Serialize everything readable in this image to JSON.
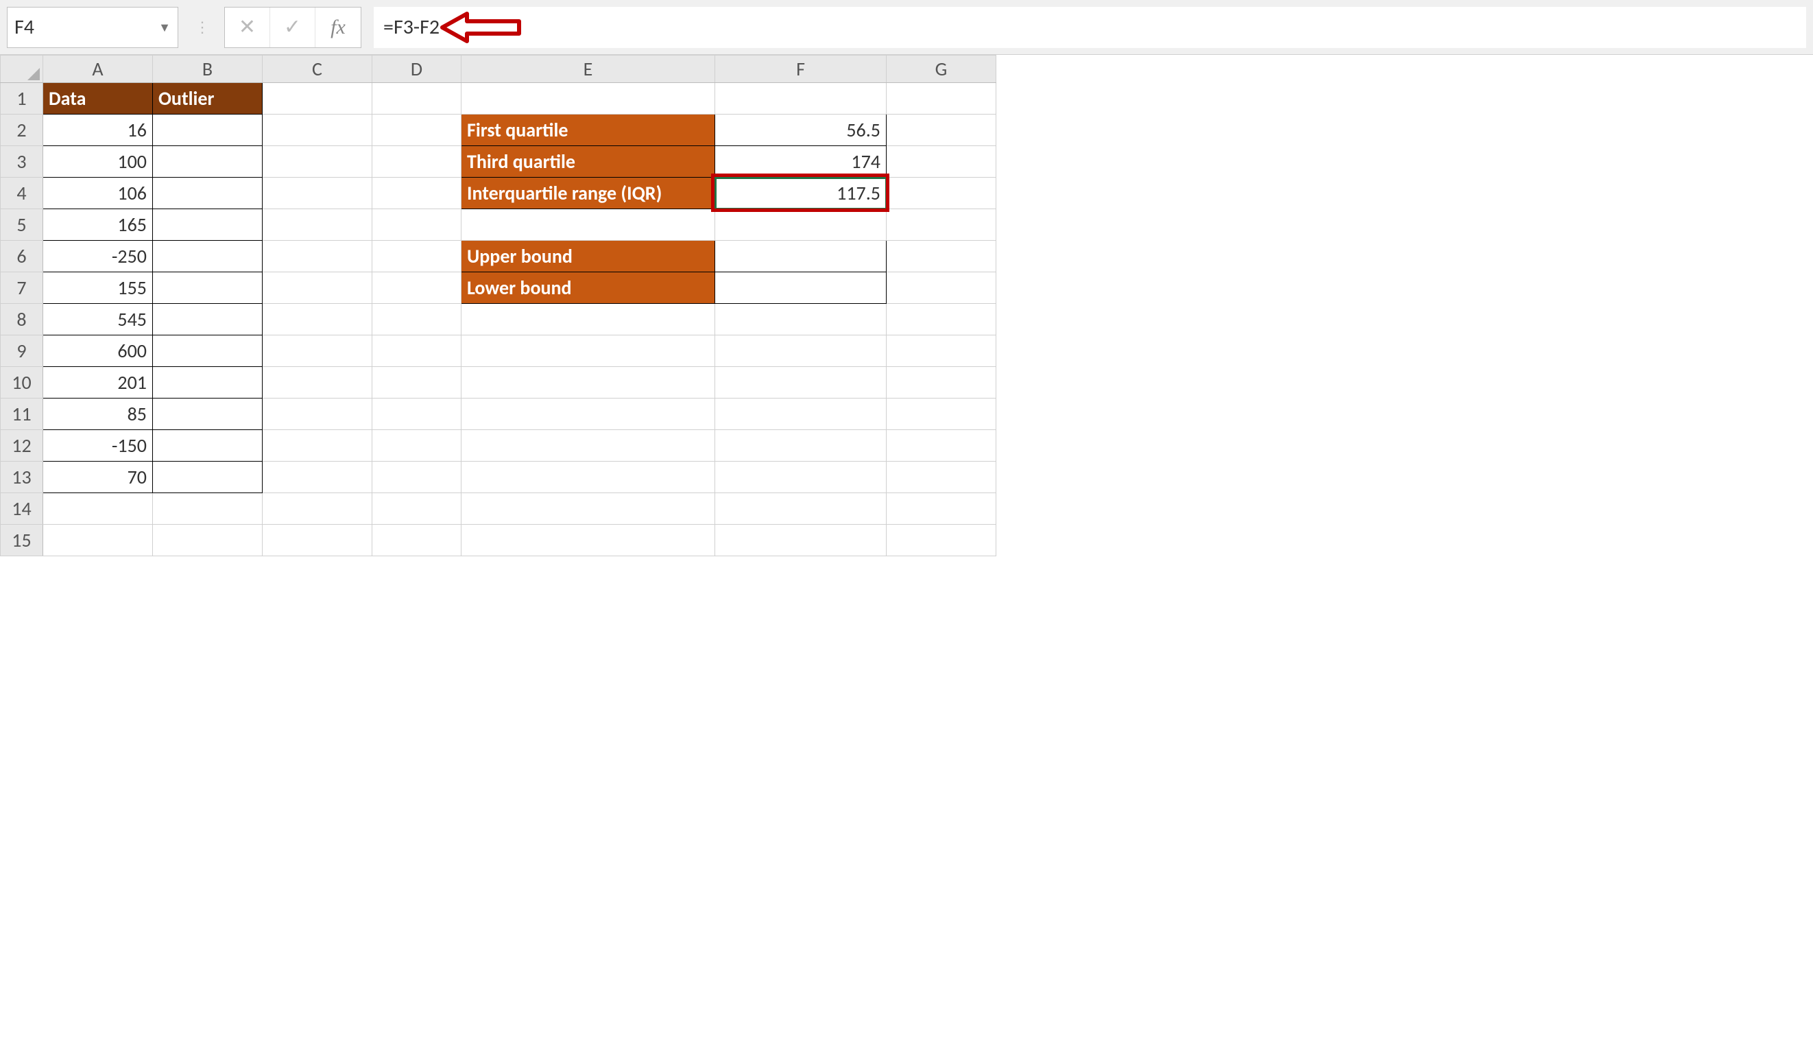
{
  "formula_bar": {
    "name_box": "F4",
    "cancel_icon": "✕",
    "enter_icon": "✓",
    "fx_icon": "fx",
    "formula": "=F3-F2"
  },
  "columns": [
    "A",
    "B",
    "C",
    "D",
    "E",
    "F",
    "G"
  ],
  "rows": [
    "1",
    "2",
    "3",
    "4",
    "5",
    "6",
    "7",
    "8",
    "9",
    "10",
    "11",
    "12",
    "13",
    "14",
    "15"
  ],
  "active_cell": {
    "row": "4",
    "col": "F"
  },
  "headers": {
    "A1": "Data",
    "B1": "Outlier"
  },
  "data_values": {
    "A2": "16",
    "A3": "100",
    "A4": "106",
    "A5": "165",
    "A6": "-250",
    "A7": "155",
    "A8": "545",
    "A9": "600",
    "A10": "201",
    "A11": "85",
    "A12": "-150",
    "A13": "70"
  },
  "labels": {
    "E2": "First quartile",
    "E3": "Third quartile",
    "E4": "Interquartile range (IQR)",
    "E6": "Upper bound",
    "E7": "Lower bound"
  },
  "values": {
    "F2": "56.5",
    "F3": "174",
    "F4": "117.5",
    "F6": "",
    "F7": ""
  }
}
